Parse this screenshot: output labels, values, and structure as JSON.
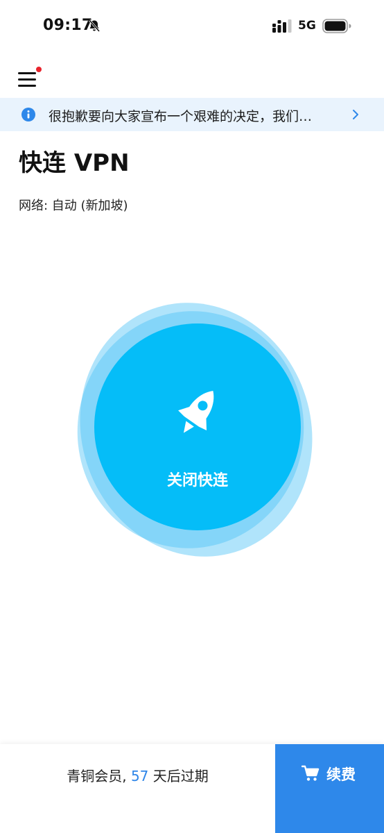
{
  "status_bar": {
    "time": "09:17",
    "network": "5G",
    "icons": [
      "bell-muted-icon",
      "cellular-signal-icon",
      "battery-icon"
    ]
  },
  "header": {
    "menu_icon": "hamburger-menu-icon",
    "has_notification_dot": true
  },
  "notice": {
    "icon": "info-icon",
    "text": "很抱歉要向大家宣布一个艰难的决定，我们…"
  },
  "page": {
    "title": "快连 VPN",
    "network_label": "网络: 自动 (新加坡)"
  },
  "connect": {
    "label": "关闭快连",
    "icon": "rocket-icon"
  },
  "footer": {
    "membership_prefix": "青铜会员, ",
    "days": "57",
    "membership_suffix": " 天后过期",
    "renew_label": "续费",
    "renew_icon": "cart-icon"
  },
  "colors": {
    "primary": "#05bdf8",
    "accent": "#2e88ea",
    "notice_bg": "#e9f3fd",
    "notification_dot": "#e8232c"
  }
}
